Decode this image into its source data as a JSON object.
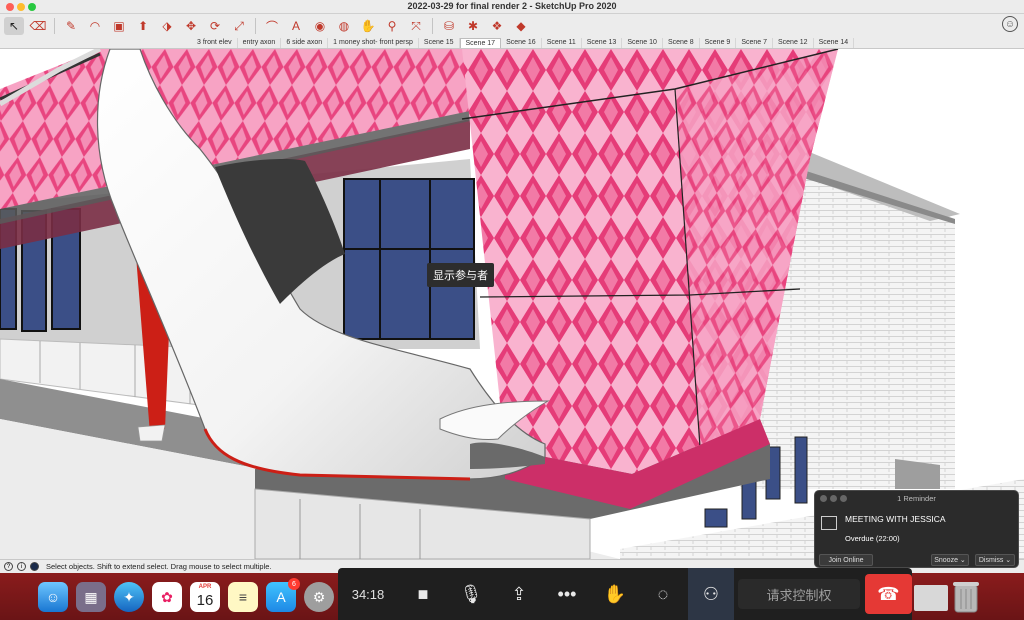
{
  "window": {
    "title": "2022-03-29 for final render 2 - SketchUp Pro 2020"
  },
  "toolbar": {
    "tools": [
      {
        "name": "select-tool-icon",
        "glyph": "↖"
      },
      {
        "name": "eraser-tool-icon",
        "glyph": "⌫"
      },
      {
        "name": "line-tool-icon",
        "glyph": "✎"
      },
      {
        "name": "arc-tool-icon",
        "glyph": "◠"
      },
      {
        "name": "shape-tool-icon",
        "glyph": "▣"
      },
      {
        "name": "push-pull-tool-icon",
        "glyph": "⬆"
      },
      {
        "name": "follow-me-tool-icon",
        "glyph": "⬗"
      },
      {
        "name": "move-tool-icon",
        "glyph": "✥"
      },
      {
        "name": "rotate-tool-icon",
        "glyph": "⟳"
      },
      {
        "name": "scale-tool-icon",
        "glyph": "⤢"
      },
      {
        "name": "tape-measure-icon",
        "glyph": "⌒"
      },
      {
        "name": "text-tool-icon",
        "glyph": "A"
      },
      {
        "name": "paint-bucket-icon",
        "glyph": "◉"
      },
      {
        "name": "orbit-tool-icon",
        "glyph": "◍"
      },
      {
        "name": "pan-tool-icon",
        "glyph": "✋"
      },
      {
        "name": "zoom-tool-icon",
        "glyph": "⚲"
      },
      {
        "name": "zoom-extents-icon",
        "glyph": "⤧"
      },
      {
        "name": "warehouse-icon",
        "glyph": "⛁"
      },
      {
        "name": "extension-warehouse-icon",
        "glyph": "✱"
      },
      {
        "name": "layout-icon",
        "glyph": "❖"
      },
      {
        "name": "ruby-icon",
        "glyph": "◆"
      }
    ]
  },
  "scenes": [
    {
      "label": "3 front elev",
      "active": false
    },
    {
      "label": "entry axon",
      "active": false
    },
    {
      "label": "6 side axon",
      "active": false
    },
    {
      "label": "1 money shot- front persp",
      "active": false
    },
    {
      "label": "Scene 15",
      "active": false
    },
    {
      "label": "Scene 17",
      "active": true
    },
    {
      "label": "Scene 16",
      "active": false
    },
    {
      "label": "Scene 11",
      "active": false
    },
    {
      "label": "Scene 13",
      "active": false
    },
    {
      "label": "Scene 10",
      "active": false
    },
    {
      "label": "Scene 8",
      "active": false
    },
    {
      "label": "Scene 9",
      "active": false
    },
    {
      "label": "Scene 7",
      "active": false
    },
    {
      "label": "Scene 12",
      "active": false
    },
    {
      "label": "Scene 14",
      "active": false
    }
  ],
  "viewport": {
    "tooltip": "显示参与者"
  },
  "status": {
    "message": "Select objects. Shift to extend select. Drag mouse to select multiple."
  },
  "dock": {
    "calendar_month": "APR",
    "calendar_day": "16",
    "appstore_badge": "6"
  },
  "meeting": {
    "timer": "34:18",
    "request_control_label": "请求控制权"
  },
  "reminder": {
    "header": "1 Reminder",
    "title": "MEETING WITH JESSICA",
    "status": "Overdue (22:00)",
    "join_label": "Join Online",
    "snooze_label": "Snooze ⌄",
    "dismiss_label": "Dismiss ⌄"
  },
  "colors": {
    "facade_pink": "#e8457f",
    "facade_light": "#f7a3c4",
    "heel_red": "#d42a1f",
    "hangup_red": "#e53935"
  }
}
